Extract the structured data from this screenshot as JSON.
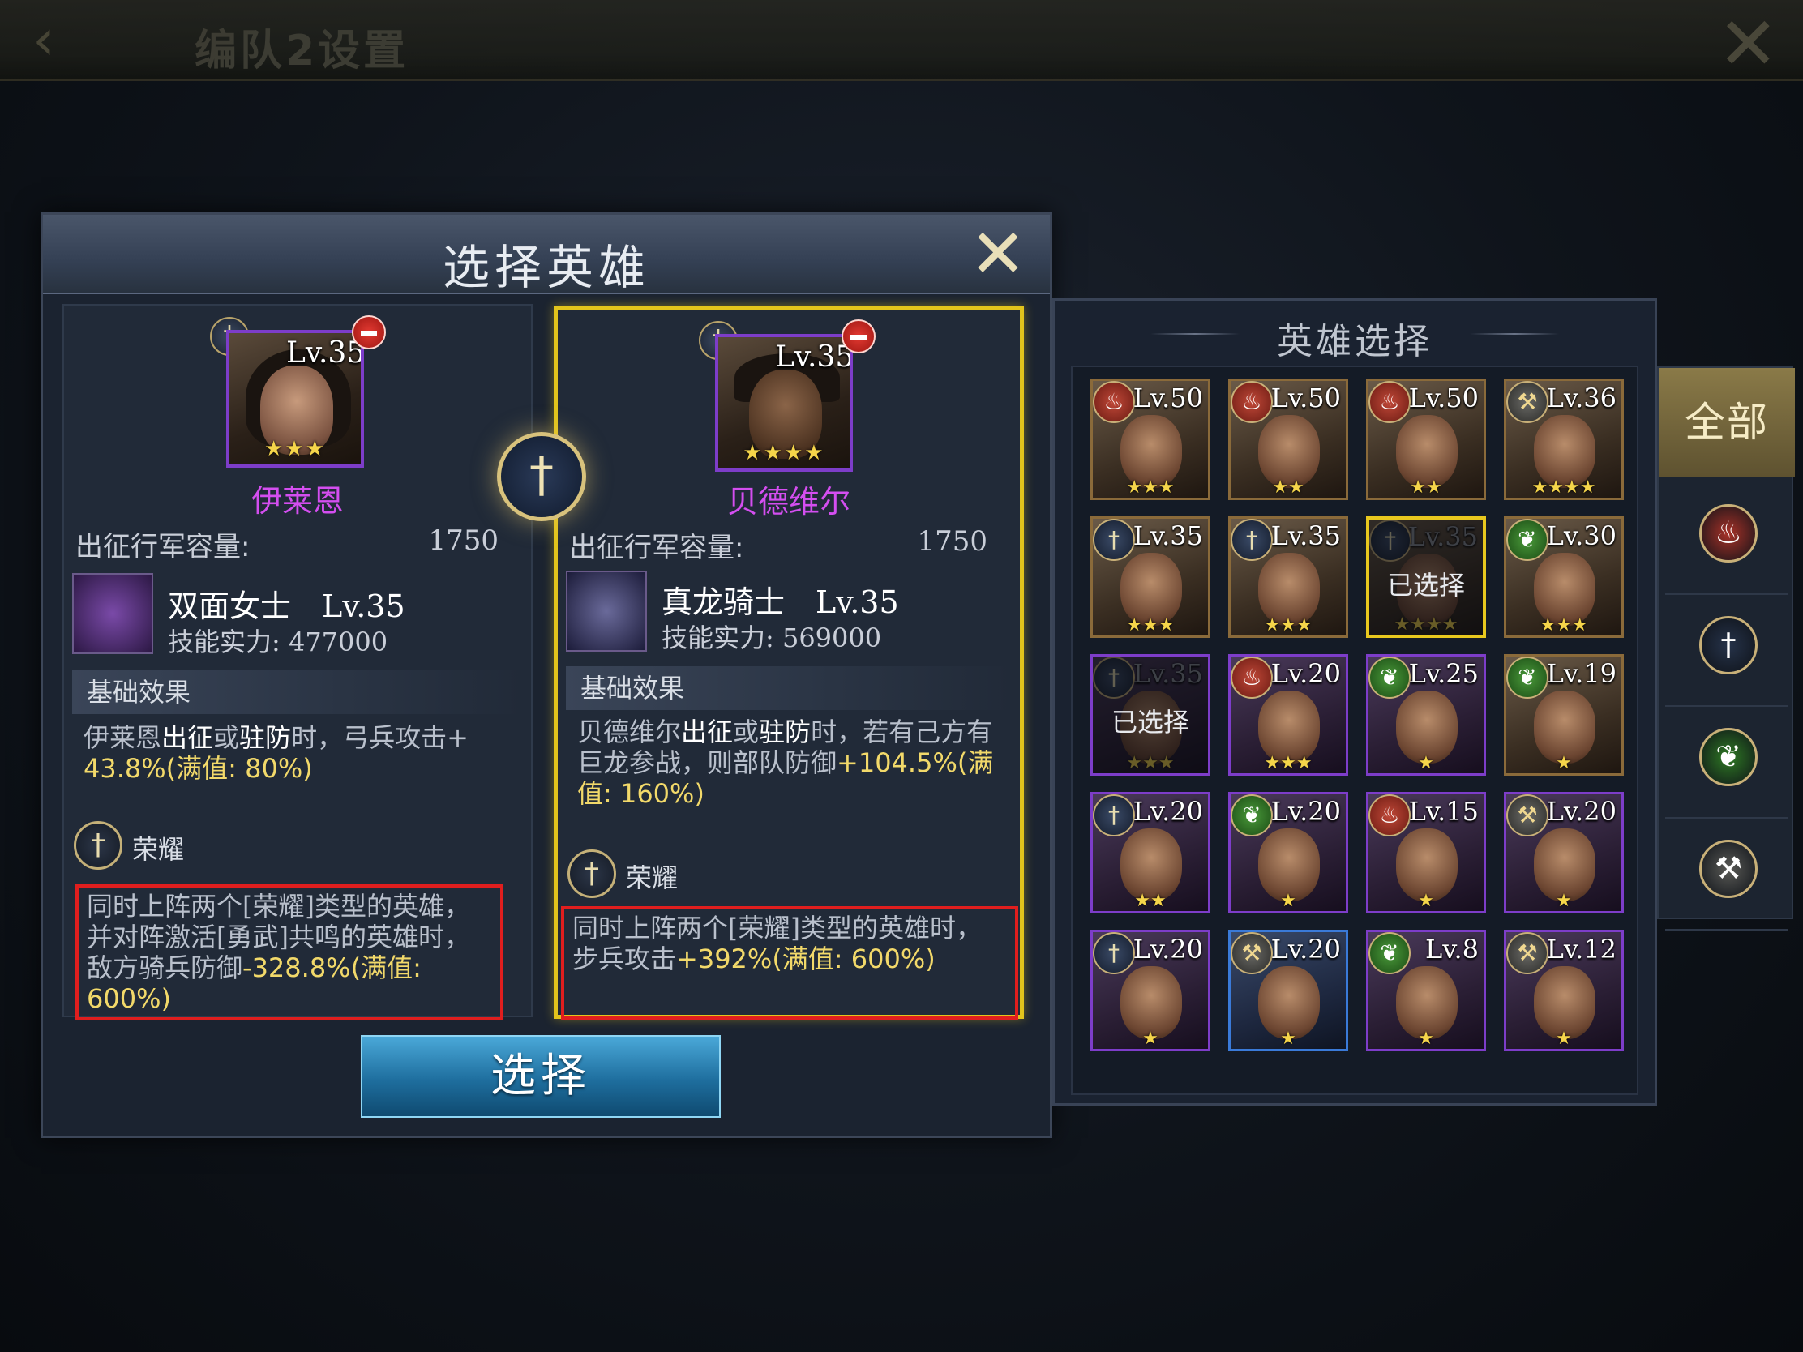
{
  "topbar": {
    "title": "编队2设置",
    "back_icon": "‹",
    "close_icon": "✕"
  },
  "dialog": {
    "title": "选择英雄",
    "close_icon": "✕",
    "select_label": "选择",
    "swap_icon": "†"
  },
  "heroes": [
    {
      "level": "Lv.35",
      "stars": "★★★",
      "name": "伊莱恩",
      "capacity_label": "出征行军容量:",
      "capacity": "1750",
      "skill_name": "双面女士　Lv.35",
      "skill_power": "技能实力:  477000",
      "base_effect_title": "基础效果",
      "base_effect_a": "伊莱恩",
      "base_effect_b": "出征",
      "base_effect_c": "或",
      "base_effect_d": "驻防",
      "base_effect_e": "时，弓兵攻击+",
      "base_effect_num": "43.8%(满值: 80%)",
      "glory_label": "荣耀",
      "glory_text_1": "同时上阵两个[荣耀]类型的英雄，",
      "glory_text_2": "并对阵激活[勇武]共鸣的英雄时，",
      "glory_text_3": "敌方骑兵防御",
      "glory_num": "-328.8%(满值: 600%)"
    },
    {
      "level": "Lv.35",
      "stars": "★★★★",
      "name": "贝德维尔",
      "capacity_label": "出征行军容量:",
      "capacity": "1750",
      "skill_name": "真龙骑士　Lv.35",
      "skill_power": "技能实力:  569000",
      "base_effect_title": "基础效果",
      "base_effect_a": "贝德维尔",
      "base_effect_b": "出征",
      "base_effect_c": "或",
      "base_effect_d": "驻防",
      "base_effect_e": "时，若有己方有巨龙参战，则部队防御",
      "base_effect_num": "+104.5%(满值: 160%)",
      "glory_label": "荣耀",
      "glory_text_1": "同时上阵两个[荣耀]类型的英雄时，步兵攻击",
      "glory_num": "+392%(满值: 600%)"
    }
  ],
  "hero_list": {
    "title": "英雄选择",
    "selected_label": "已选择",
    "cards": [
      {
        "type": "fire",
        "level": "Lv.50",
        "stars": "★★★",
        "frame": "gold",
        "state": "normal"
      },
      {
        "type": "fire",
        "level": "Lv.50",
        "stars": "★★",
        "frame": "gold",
        "state": "normal"
      },
      {
        "type": "fire",
        "level": "Lv.50",
        "stars": "★★",
        "frame": "gold",
        "state": "normal"
      },
      {
        "type": "hammer",
        "level": "Lv.36",
        "stars": "★★★★",
        "frame": "gold",
        "state": "normal"
      },
      {
        "type": "sword",
        "level": "Lv.35",
        "stars": "★★★",
        "frame": "gold",
        "state": "normal"
      },
      {
        "type": "sword",
        "level": "Lv.35",
        "stars": "★★★",
        "frame": "gold",
        "state": "normal"
      },
      {
        "type": "sword",
        "level": "Lv.35",
        "stars": "★★★★",
        "frame": "gold",
        "state": "selected-current"
      },
      {
        "type": "leaf",
        "level": "Lv.30",
        "stars": "★★★",
        "frame": "gold",
        "state": "normal"
      },
      {
        "type": "sword",
        "level": "Lv.35",
        "stars": "★★★",
        "frame": "purple",
        "state": "selected"
      },
      {
        "type": "fire",
        "level": "Lv.20",
        "stars": "★★★",
        "frame": "purple",
        "state": "normal"
      },
      {
        "type": "leaf",
        "level": "Lv.25",
        "stars": "★",
        "frame": "purple",
        "state": "normal"
      },
      {
        "type": "leaf",
        "level": "Lv.19",
        "stars": "★",
        "frame": "gold",
        "state": "normal"
      },
      {
        "type": "sword",
        "level": "Lv.20",
        "stars": "★★",
        "frame": "purple",
        "state": "normal"
      },
      {
        "type": "leaf",
        "level": "Lv.20",
        "stars": "★",
        "frame": "purple",
        "state": "normal"
      },
      {
        "type": "fire",
        "level": "Lv.15",
        "stars": "★",
        "frame": "purple",
        "state": "normal"
      },
      {
        "type": "hammer",
        "level": "Lv.20",
        "stars": "★",
        "frame": "purple",
        "state": "normal"
      },
      {
        "type": "sword",
        "level": "Lv.20",
        "stars": "★",
        "frame": "purple",
        "state": "normal"
      },
      {
        "type": "hammer",
        "level": "Lv.20",
        "stars": "★",
        "frame": "blue",
        "state": "normal"
      },
      {
        "type": "leaf",
        "level": "Lv.8",
        "stars": "★",
        "frame": "purple",
        "state": "normal"
      },
      {
        "type": "hammer",
        "level": "Lv.12",
        "stars": "★",
        "frame": "purple",
        "state": "normal"
      }
    ]
  },
  "filters": {
    "all_label": "全部",
    "items": [
      {
        "name": "fire",
        "glyph": "♨",
        "color": "#a83228"
      },
      {
        "name": "sword",
        "glyph": "†",
        "color": "#26334a"
      },
      {
        "name": "leaf",
        "glyph": "❦",
        "color": "#2f7a24"
      },
      {
        "name": "hammer",
        "glyph": "⚒",
        "color": "#5a5a56"
      }
    ]
  },
  "icons": {
    "fire": "♨",
    "sword": "†",
    "leaf": "❦",
    "hammer": "⚒"
  }
}
